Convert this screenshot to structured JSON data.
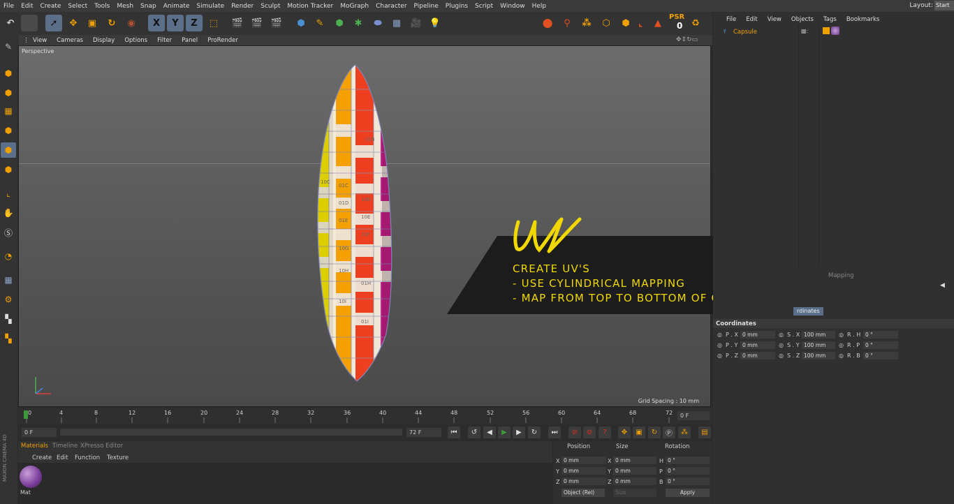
{
  "menubar": {
    "items": [
      "File",
      "Edit",
      "Create",
      "Select",
      "Tools",
      "Mesh",
      "Snap",
      "Animate",
      "Simulate",
      "Render",
      "Sculpt",
      "Motion Tracker",
      "MoGraph",
      "Character",
      "Pipeline",
      "Plugins",
      "Script",
      "Window",
      "Help"
    ],
    "layout_label": "Layout:",
    "layout_value": "Start"
  },
  "toolbar": {
    "axis_x": "X",
    "axis_y": "Y",
    "axis_z": "Z",
    "psr_label": "PSR",
    "psr_value": "0"
  },
  "viewport": {
    "menu": [
      "View",
      "Cameras",
      "Display",
      "Options",
      "Filter",
      "Panel",
      "ProRender"
    ],
    "label": "Perspective",
    "grid_spacing": "Grid Spacing : 10 mm"
  },
  "object_labels": [
    "01B",
    "10C",
    "01C",
    "10D",
    "01D",
    "10E",
    "01E",
    "10F",
    "10G",
    "10H",
    "01H",
    "10I",
    "01I"
  ],
  "timeline": {
    "ticks": [
      "0",
      "4",
      "8",
      "12",
      "16",
      "20",
      "24",
      "28",
      "32",
      "36",
      "40",
      "44",
      "48",
      "52",
      "56",
      "60",
      "64",
      "68",
      "72"
    ],
    "end_frame": "0 F",
    "start_field": "0 F",
    "end_field": "72 F",
    "current_field": "0 F"
  },
  "materials": {
    "tabs": [
      "Materials",
      "Timeline",
      "XPresso Editor"
    ],
    "menu": [
      "Create",
      "Edit",
      "Function",
      "Texture"
    ],
    "swatch_label": "Mat"
  },
  "coords_panel": {
    "headers": [
      "Position",
      "Size",
      "Rotation"
    ],
    "rows": [
      {
        "axis": "X",
        "pos": "0 mm",
        "size_axis": "X",
        "size": "0 mm",
        "rot_axis": "H",
        "rot": "0 °"
      },
      {
        "axis": "Y",
        "pos": "0 mm",
        "size_axis": "Y",
        "size": "0 mm",
        "rot_axis": "P",
        "rot": "0 °"
      },
      {
        "axis": "Z",
        "pos": "0 mm",
        "size_axis": "Z",
        "size": "0 mm",
        "rot_axis": "B",
        "rot": "0 °"
      }
    ],
    "mode": "Object (Rel)",
    "size_mode": "Size",
    "apply": "Apply"
  },
  "object_manager": {
    "menu": [
      "File",
      "Edit",
      "View",
      "Objects",
      "Tags",
      "Bookmarks"
    ],
    "object_name": "Capsule"
  },
  "attributes": {
    "tab_mapping": "Mapping",
    "tab_coords_short": "rdinates",
    "section": "Coordinates",
    "rows": [
      {
        "a": "P . X",
        "av": "0 mm",
        "b": "S . X",
        "bv": "100 mm",
        "c": "R . H",
        "cv": "0 °"
      },
      {
        "a": "P . Y",
        "av": "0 mm",
        "b": "S . Y",
        "bv": "100 mm",
        "c": "R . P",
        "cv": "0 °"
      },
      {
        "a": "P . Z",
        "av": "0 mm",
        "b": "S . Z",
        "bv": "100 mm",
        "c": "R . B",
        "cv": "0 °"
      }
    ]
  },
  "overlay": {
    "logo": "UV",
    "line1": "CREATE UV'S",
    "line2": "- USE CYLINDRICAL MAPPING",
    "line3": "- MAP FROM TOP TO BOTTOM OF OBJECT"
  },
  "watermark": "MAXON CINEMA 4D",
  "colors": {
    "accent_yellow": "#f0d800",
    "selected_blue": "#5b6f8a",
    "orange_object": "#f0a000"
  }
}
